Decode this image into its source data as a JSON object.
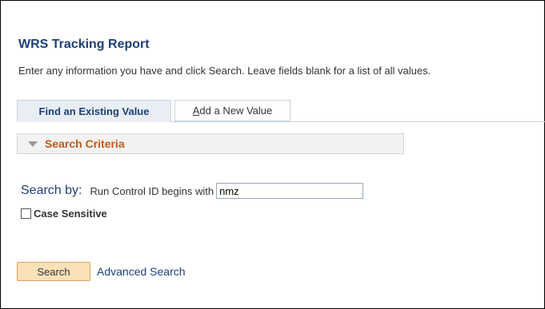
{
  "page": {
    "title": "WRS Tracking Report",
    "instructions": "Enter any information you have and click Search. Leave fields blank for a list of all values."
  },
  "tabs": [
    {
      "label": "Find an Existing Value",
      "active": true
    },
    {
      "label_first": "A",
      "label_rest": "dd a New Value",
      "active": false
    }
  ],
  "search_criteria": {
    "header": "Search Criteria",
    "expanded": true
  },
  "search": {
    "search_by_label": "Search by:",
    "field_label": "Run Control ID begins with",
    "field_value": "nmz"
  },
  "case_sensitive": {
    "label": "Case Sensitive",
    "checked": false
  },
  "actions": {
    "search_button": "Search",
    "advanced_link": "Advanced Search"
  },
  "colors": {
    "title": "#1f3f77",
    "criteria_header": "#bf5a1a",
    "search_button_bg": "#fbe1b8"
  }
}
